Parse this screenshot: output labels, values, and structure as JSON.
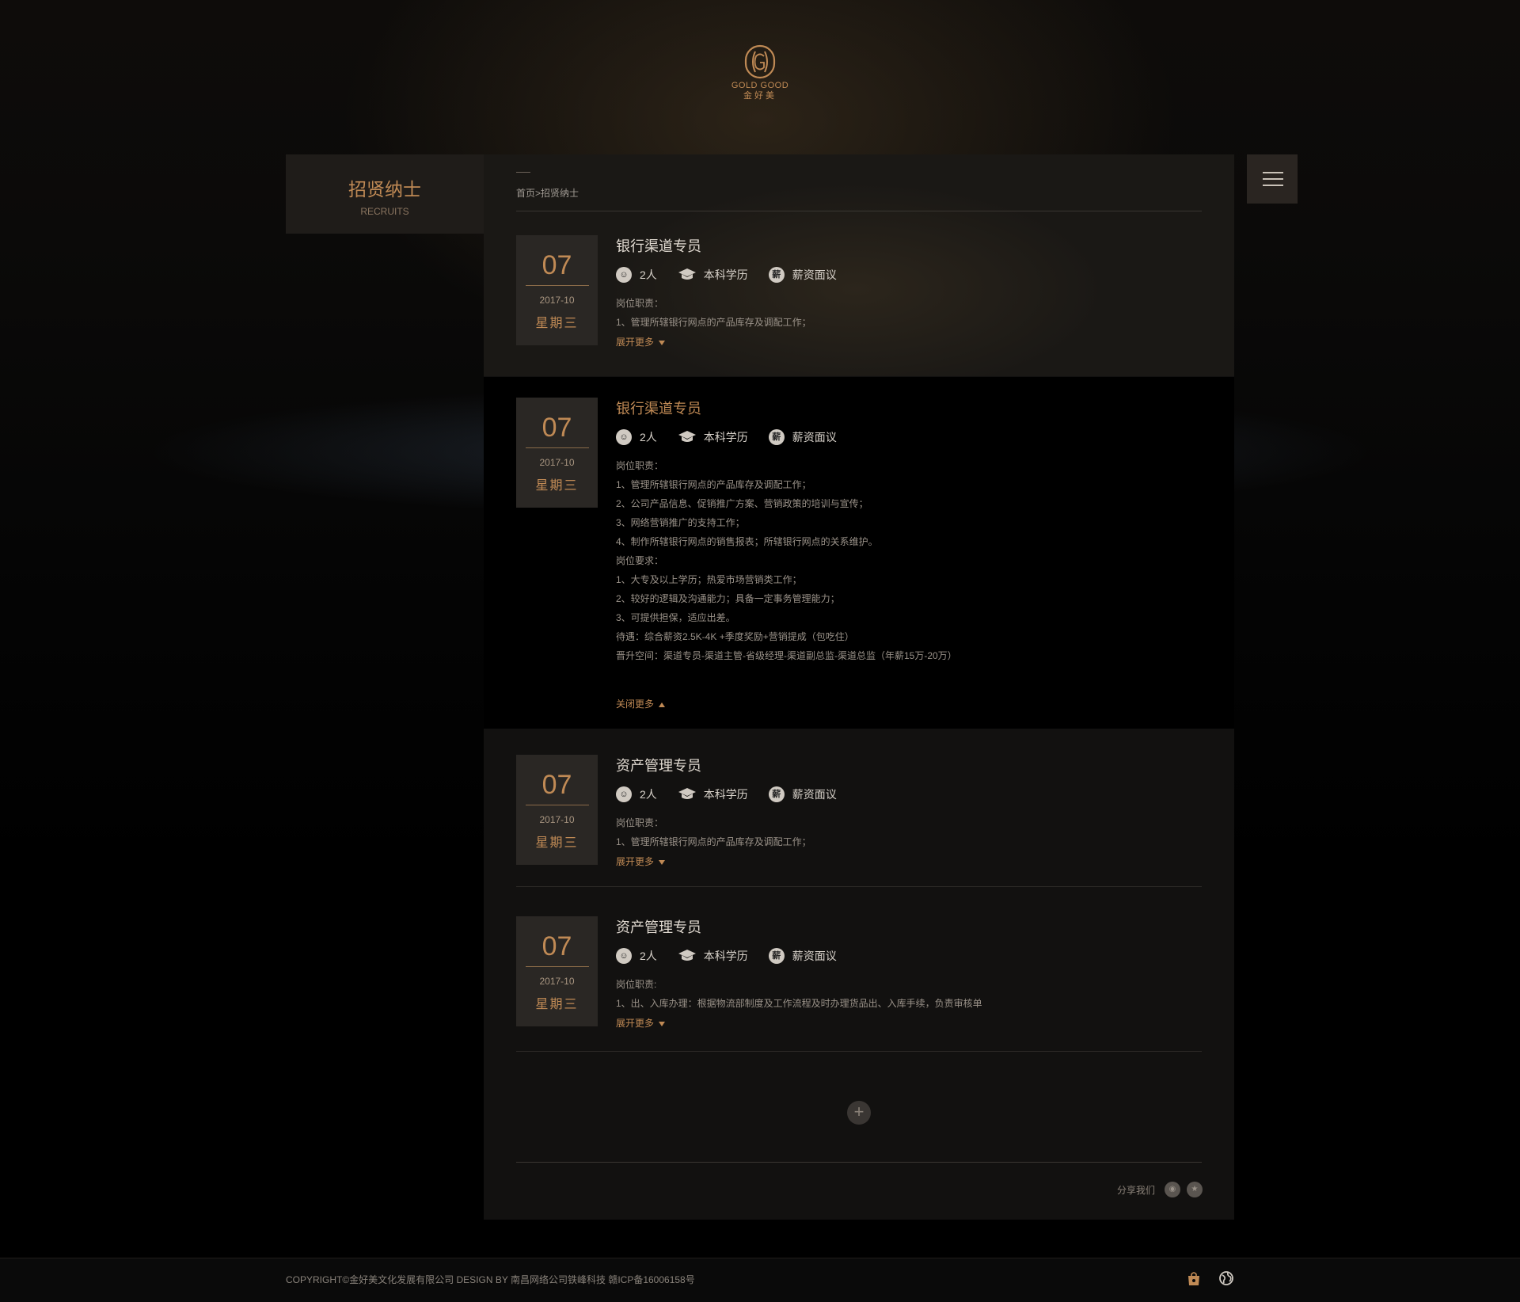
{
  "logo": {
    "en": "GOLD GOOD",
    "cn": "金好美"
  },
  "sidebar": {
    "title": "招贤纳士",
    "subtitle": "RECRUITS"
  },
  "menu": {
    "icon": "hamburger-menu-icon"
  },
  "breadcrumb": {
    "home": "首页",
    "separator": ">",
    "current": "招贤纳士"
  },
  "jobs": [
    {
      "day": "07",
      "year_month": "2017-10",
      "weekday": "星期三",
      "title": "银行渠道专员",
      "count": "2人",
      "education": "本科学历",
      "salary_icon": "薪",
      "salary": "薪资面议",
      "desc": [
        "岗位职责：",
        "1、管理所辖银行网点的产品库存及调配工作；"
      ],
      "toggle": "展开更多"
    },
    {
      "day": "07",
      "year_month": "2017-10",
      "weekday": "星期三",
      "title": "银行渠道专员",
      "count": "2人",
      "education": "本科学历",
      "salary_icon": "薪",
      "salary": "薪资面议",
      "desc": [
        "岗位职责：",
        "1、管理所辖银行网点的产品库存及调配工作；",
        "2、公司产品信息、促销推广方案、营销政策的培训与宣传；",
        "3、网络营销推广的支持工作；",
        "4、制作所辖银行网点的销售报表；所辖银行网点的关系维护。",
        "岗位要求：",
        "1、大专及以上学历；热爱市场营销类工作；",
        "2、较好的逻辑及沟通能力；具备一定事务管理能力；",
        "3、可提供担保，适应出差。",
        "待遇：综合薪资2.5K-4K +季度奖励+营销提成（包吃住）",
        "晋升空间：渠道专员-渠道主管-省级经理-渠道副总监-渠道总监（年薪15万-20万）"
      ],
      "toggle": "关闭更多"
    },
    {
      "day": "07",
      "year_month": "2017-10",
      "weekday": "星期三",
      "title": "资产管理专员",
      "count": "2人",
      "education": "本科学历",
      "salary_icon": "薪",
      "salary": "薪资面议",
      "desc": [
        "岗位职责：",
        "1、管理所辖银行网点的产品库存及调配工作；"
      ],
      "toggle": "展开更多"
    },
    {
      "day": "07",
      "year_month": "2017-10",
      "weekday": "星期三",
      "title": "资产管理专员",
      "count": "2人",
      "education": "本科学历",
      "salary_icon": "薪",
      "salary": "薪资面议",
      "desc": [
        "岗位职责:",
        "1、出、入库办理：根据物流部制度及工作流程及时办理货品出、入库手续，负责审核单"
      ],
      "toggle": "展开更多"
    }
  ],
  "load_more": "+",
  "share": {
    "label": "分享我们"
  },
  "footer": {
    "copyright": "COPYRIGHT©金好美文化发展有限公司 DESIGN BY 南昌网络公司铁峰科技 赣ICP备16006158号"
  },
  "colors": {
    "accent": "#c08a55",
    "panel": "#121110",
    "date_box": "#2a2724"
  }
}
